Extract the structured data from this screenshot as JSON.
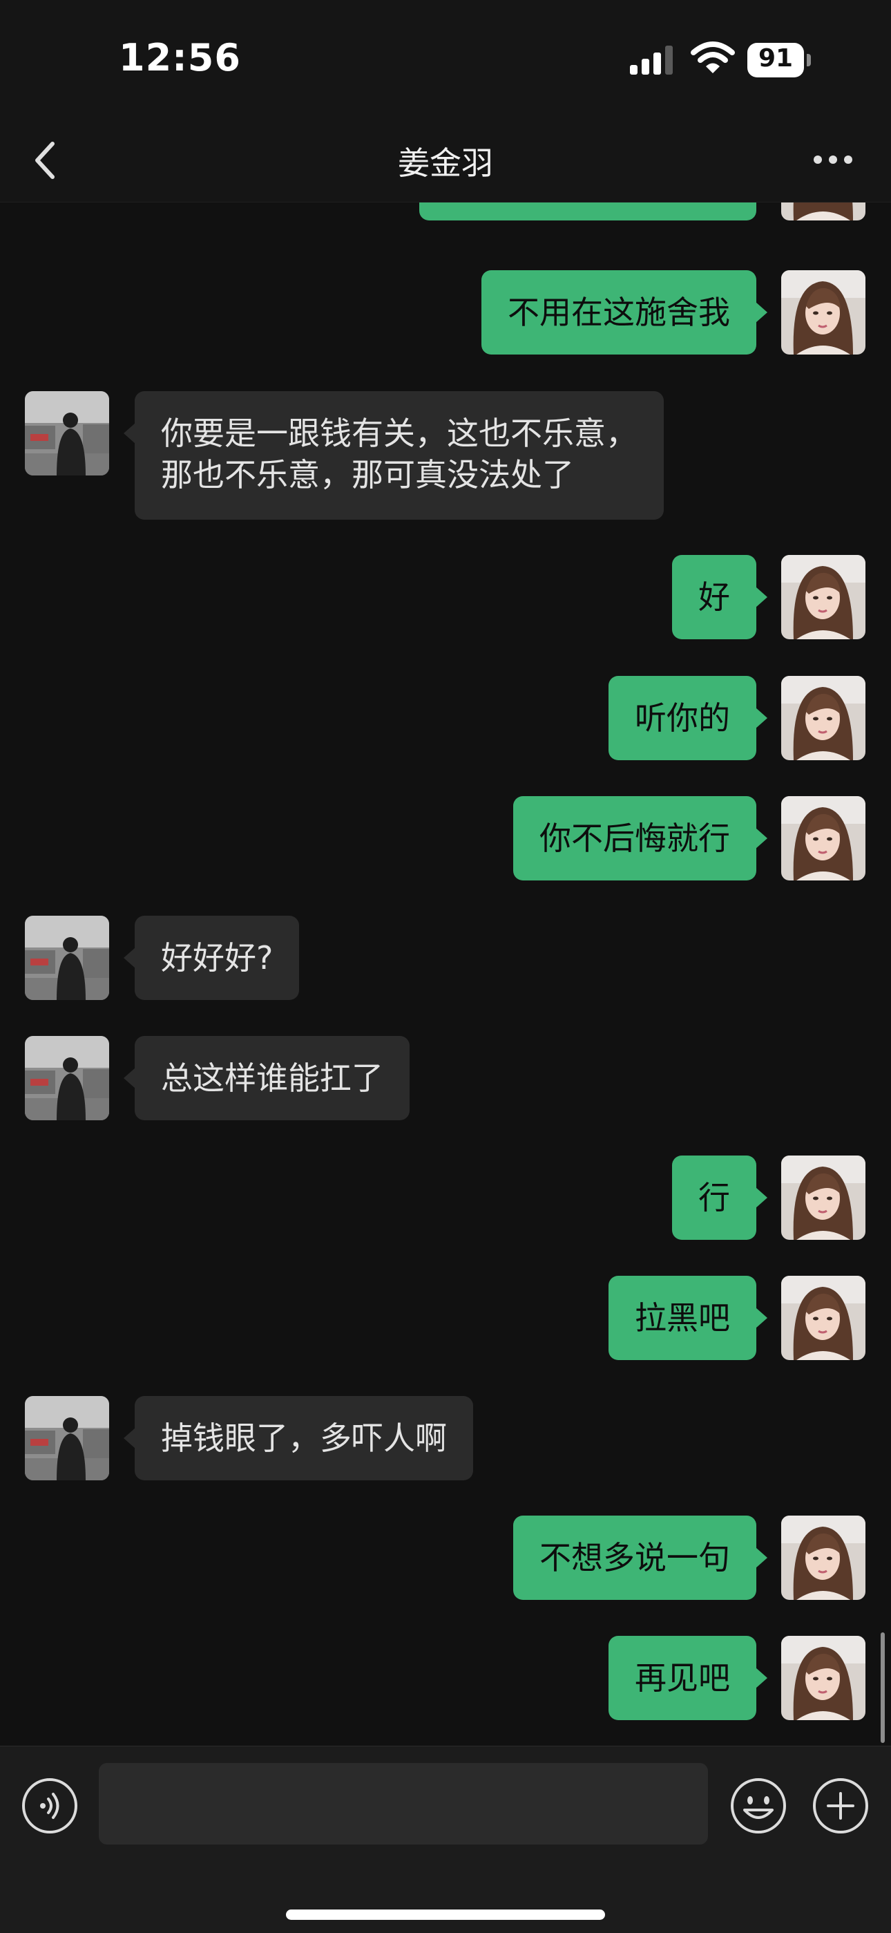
{
  "status_bar": {
    "time": "12:56",
    "battery": "91"
  },
  "header": {
    "title": "姜金羽"
  },
  "messages": [
    {
      "sender": "me",
      "text": ""
    },
    {
      "sender": "me",
      "text": "不用在这施舍我"
    },
    {
      "sender": "other",
      "text": "你要是一跟钱有关，这也不乐意，\n那也不乐意，那可真没法处了"
    },
    {
      "sender": "me",
      "text": "好"
    },
    {
      "sender": "me",
      "text": "听你的"
    },
    {
      "sender": "me",
      "text": "你不后悔就行"
    },
    {
      "sender": "other",
      "text": "好好好?"
    },
    {
      "sender": "other",
      "text": "总这样谁能扛了"
    },
    {
      "sender": "me",
      "text": "行"
    },
    {
      "sender": "me",
      "text": "拉黑吧"
    },
    {
      "sender": "other",
      "text": "掉钱眼了，多吓人啊"
    },
    {
      "sender": "me",
      "text": "不想多说一句"
    },
    {
      "sender": "me",
      "text": "再见吧"
    }
  ],
  "input_bar": {
    "value": ""
  },
  "colors": {
    "bubble_me": "#3eb575",
    "bubble_other": "#2b2b2b",
    "background": "#111111"
  },
  "icons": [
    "back-icon",
    "more-icon",
    "voice-icon",
    "emoji-icon",
    "plus-icon"
  ]
}
